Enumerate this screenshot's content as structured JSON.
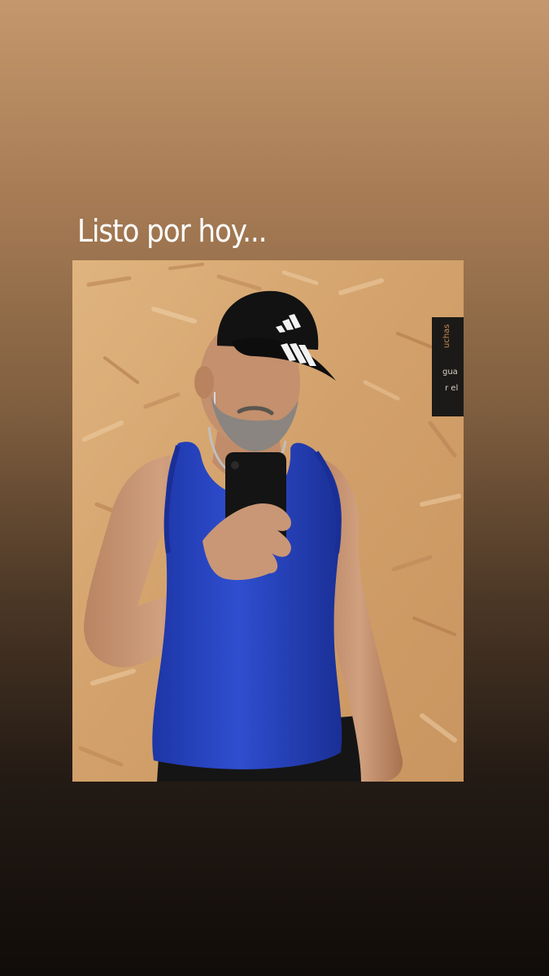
{
  "story": {
    "caption": "Listo por hoy...",
    "photo": {
      "subject": "mirror-selfie",
      "sign_text_lines": [
        "uchas",
        "gua",
        "r el"
      ]
    }
  },
  "colors": {
    "gradient_top": "#c5976c",
    "gradient_bottom": "#100c09",
    "caption_text": "#ffffff",
    "tank_top": "#2a46c2",
    "cap": "#121212",
    "wall": "#d3a26c"
  }
}
